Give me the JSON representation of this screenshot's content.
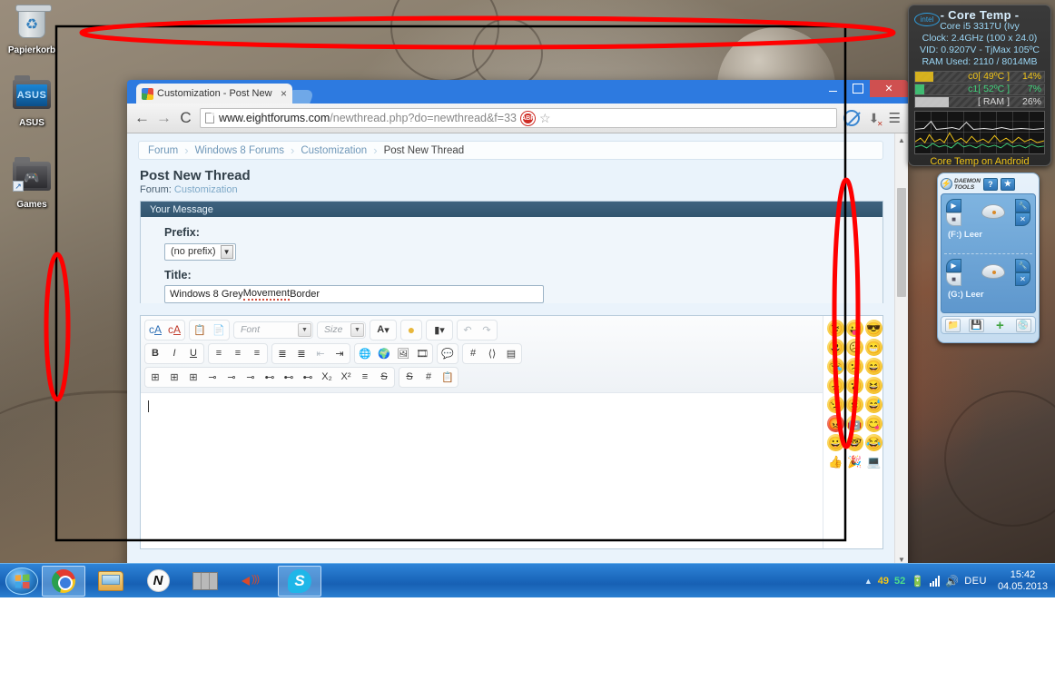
{
  "desktop": {
    "icons": [
      {
        "name": "recycle-bin",
        "label": "Papierkorb"
      },
      {
        "name": "asus-folder",
        "label": "ASUS"
      },
      {
        "name": "games-folder",
        "label": "Games"
      }
    ]
  },
  "taskbar": {
    "start_label": "Start",
    "buttons": [
      {
        "name": "chrome",
        "label": "Google Chrome"
      },
      {
        "name": "explorer",
        "label": "Windows Explorer"
      },
      {
        "name": "nitro",
        "label": "N"
      },
      {
        "name": "firewall",
        "label": "Firewall"
      },
      {
        "name": "volume",
        "label": "Volume"
      },
      {
        "name": "skype",
        "label": "S"
      }
    ],
    "tray": {
      "show_hidden": "▲",
      "temp_core0": "49",
      "temp_core1": "52",
      "language": "DEU",
      "time": "15:42",
      "date": "04.05.2013"
    }
  },
  "coretemp": {
    "brand": "intel",
    "title": "- Core Temp -",
    "cpu": "Core i5 3317U (Ivy",
    "clock": "Clock: 2.4GHz (100 x 24.0)",
    "vid": "VID: 0.9207V - TjMax 105ºC",
    "ram": "RAM Used: 2110 / 8014MB",
    "bars": [
      {
        "name": "c0",
        "label": "c0[ 49ºC ]",
        "percent": "14%",
        "value": 14,
        "color": "#f0c419"
      },
      {
        "name": "c1",
        "label": "c1[ 52ºC ]",
        "percent": "7%",
        "value": 7,
        "color": "#3fd07a"
      },
      {
        "name": "ram",
        "label": "[ RAM ]",
        "percent": "26%",
        "value": 26,
        "color": "#d8d8d8"
      }
    ],
    "footer": "Core Temp on Android"
  },
  "daemon": {
    "logo_label": "DAEMON TOOLS",
    "help_label": "?",
    "settings_label": "✳",
    "drives": [
      {
        "name": "drive-f",
        "label": "(F:) Leer"
      },
      {
        "name": "drive-g",
        "label": "(G:) Leer"
      }
    ],
    "footer_buttons": [
      {
        "name": "mount-image",
        "glyph": "📁"
      },
      {
        "name": "add-image",
        "glyph": "💾"
      },
      {
        "name": "add-drive",
        "glyph": "+"
      },
      {
        "name": "burn",
        "glyph": "💿"
      }
    ]
  },
  "chrome": {
    "tab": {
      "title": "Customization - Post New",
      "close": "×"
    },
    "new_tab_label": "+",
    "window_controls": {
      "minimize": "–",
      "maximize": "□",
      "close": "✕"
    },
    "nav": {
      "back": "←",
      "forward": "→",
      "reload": "C"
    },
    "omnibox": {
      "url_bold": "www.eightforums.com",
      "url_rest": "/newthread.php?do=newthread&f=33",
      "abp_label": "ABP",
      "star": "☆"
    },
    "toolbar_icons": [
      {
        "name": "noscript-icon",
        "label": "NoScript"
      },
      {
        "name": "download-icon",
        "label": "Downloads"
      },
      {
        "name": "chrome-menu-icon",
        "label": "☰"
      }
    ]
  },
  "forum": {
    "breadcrumb": [
      {
        "label": "Forum",
        "current": false
      },
      {
        "label": "Windows 8 Forums",
        "current": false
      },
      {
        "label": "Customization",
        "current": false
      },
      {
        "label": "Post New Thread",
        "current": true
      }
    ],
    "breadcrumb_sep": "›",
    "page_title": "Post New Thread",
    "forum_prefix_label": "Forum:",
    "forum_name": "Customization",
    "panel_header": "Your Message",
    "prefix_label": "Prefix:",
    "prefix_value": "(no prefix)",
    "title_label": "Title:",
    "title_value_pre": "Windows 8 Grey ",
    "title_value_misspelled": "Movement",
    "title_value_post": " Border",
    "editor": {
      "font_placeholder": "Font",
      "size_placeholder": "Size",
      "row1": [
        {
          "name": "remove-format-button",
          "glyph": "ᴬ̲A̲"
        },
        {
          "name": "clear-styles-button",
          "glyph": "ᴬ̶A̶"
        },
        {
          "name": "paste-button",
          "glyph": "📋"
        },
        {
          "name": "paste-word-button",
          "glyph": "📄"
        },
        {
          "name": "font-color-button",
          "glyph": "A"
        },
        {
          "name": "highlight-color-button",
          "glyph": "●"
        },
        {
          "name": "insert-special-button",
          "glyph": "❙"
        },
        {
          "name": "undo-button",
          "glyph": "↶"
        },
        {
          "name": "redo-button",
          "glyph": "↷"
        }
      ],
      "row2": [
        {
          "name": "bold-button",
          "glyph": "B"
        },
        {
          "name": "italic-button",
          "glyph": "I"
        },
        {
          "name": "underline-button",
          "glyph": "U"
        },
        {
          "name": "align-left-button",
          "glyph": "≡"
        },
        {
          "name": "align-center-button",
          "glyph": "≡"
        },
        {
          "name": "align-right-button",
          "glyph": "≡"
        },
        {
          "name": "ordered-list-button",
          "glyph": "≣"
        },
        {
          "name": "unordered-list-button",
          "glyph": "≣"
        },
        {
          "name": "outdent-button",
          "glyph": "←"
        },
        {
          "name": "indent-button",
          "glyph": "→"
        },
        {
          "name": "insert-link-button",
          "glyph": "🌐"
        },
        {
          "name": "remove-link-button",
          "glyph": "🌍"
        },
        {
          "name": "insert-image-button",
          "glyph": "🖼"
        },
        {
          "name": "insert-video-button",
          "glyph": "🎞"
        },
        {
          "name": "insert-quote-button",
          "glyph": "💬"
        },
        {
          "name": "insert-code-button",
          "glyph": "#"
        },
        {
          "name": "insert-html-button",
          "glyph": "‹›"
        },
        {
          "name": "insert-php-button",
          "glyph": "▤"
        }
      ],
      "row3": [
        {
          "name": "insert-table-button",
          "glyph": "⊞"
        },
        {
          "name": "table-properties-button",
          "glyph": "⊞"
        },
        {
          "name": "delete-table-button",
          "glyph": "⊞"
        },
        {
          "name": "insert-row-button",
          "glyph": "⌸"
        },
        {
          "name": "insert-row-before-button",
          "glyph": "⌸"
        },
        {
          "name": "insert-row-after-button",
          "glyph": "⌸"
        },
        {
          "name": "insert-column-button",
          "glyph": "⌷"
        },
        {
          "name": "insert-column-after-button",
          "glyph": "⌷"
        },
        {
          "name": "delete-column-button",
          "glyph": "⌷"
        },
        {
          "name": "subscript-button",
          "glyph": "X₂"
        },
        {
          "name": "superscript-button",
          "glyph": "X²"
        },
        {
          "name": "justify-button",
          "glyph": "≡"
        },
        {
          "name": "strikethrough-button",
          "glyph": "S"
        },
        {
          "name": "strike2-button",
          "glyph": "S"
        },
        {
          "name": "hash-button",
          "glyph": "#"
        },
        {
          "name": "paste-plain-button",
          "glyph": "📋"
        }
      ],
      "message_value": ""
    },
    "smileys": [
      {
        "name": "smiley-wink",
        "glyph": "😉",
        "style": ""
      },
      {
        "name": "smiley-tongue",
        "glyph": "😛",
        "style": ""
      },
      {
        "name": "smiley-cool-anim",
        "glyph": "😎",
        "style": ""
      },
      {
        "name": "smiley-big-grin",
        "glyph": "😃",
        "style": ""
      },
      {
        "name": "smiley-frown",
        "glyph": "☹",
        "style": ""
      },
      {
        "name": "smiley-anim2",
        "glyph": "😁",
        "style": ""
      },
      {
        "name": "smiley-sleepy",
        "glyph": "😪",
        "style": ""
      },
      {
        "name": "smiley-confused",
        "glyph": "😕",
        "style": ""
      },
      {
        "name": "smiley-anim3",
        "glyph": "😄",
        "style": ""
      },
      {
        "name": "smiley-sad",
        "glyph": "😞",
        "style": ""
      },
      {
        "name": "smiley-surprised",
        "glyph": "😮",
        "style": ""
      },
      {
        "name": "smiley-anim4",
        "glyph": "😆",
        "style": ""
      },
      {
        "name": "smiley-skeptical",
        "glyph": "😒",
        "style": ""
      },
      {
        "name": "smiley-neutral",
        "glyph": "😐",
        "style": ""
      },
      {
        "name": "smiley-anim5",
        "glyph": "😅",
        "style": ""
      },
      {
        "name": "smiley-angry",
        "glyph": "😡",
        "style": "red"
      },
      {
        "name": "smiley-robot",
        "glyph": "🤖",
        "style": ""
      },
      {
        "name": "smiley-anim6",
        "glyph": "😋",
        "style": ""
      },
      {
        "name": "smiley-happy",
        "glyph": "😀",
        "style": ""
      },
      {
        "name": "smiley-nerd",
        "glyph": "🤓",
        "style": ""
      },
      {
        "name": "smiley-anim7",
        "glyph": "😂",
        "style": ""
      },
      {
        "name": "smiley-thumbsup",
        "glyph": "👍",
        "style": "none"
      },
      {
        "name": "smiley-party",
        "glyph": "🎉",
        "style": "none"
      },
      {
        "name": "smiley-computer",
        "glyph": "💻",
        "style": "none"
      }
    ]
  },
  "annotations": {
    "accent_color": "#ff0000",
    "border_color": "#000000",
    "shapes": [
      {
        "name": "annotation-ellipse-top",
        "type": "ellipse"
      },
      {
        "name": "annotation-ellipse-left",
        "type": "ellipse"
      },
      {
        "name": "annotation-ellipse-right",
        "type": "ellipse"
      },
      {
        "name": "annotation-rectangle",
        "type": "rectangle"
      }
    ]
  }
}
